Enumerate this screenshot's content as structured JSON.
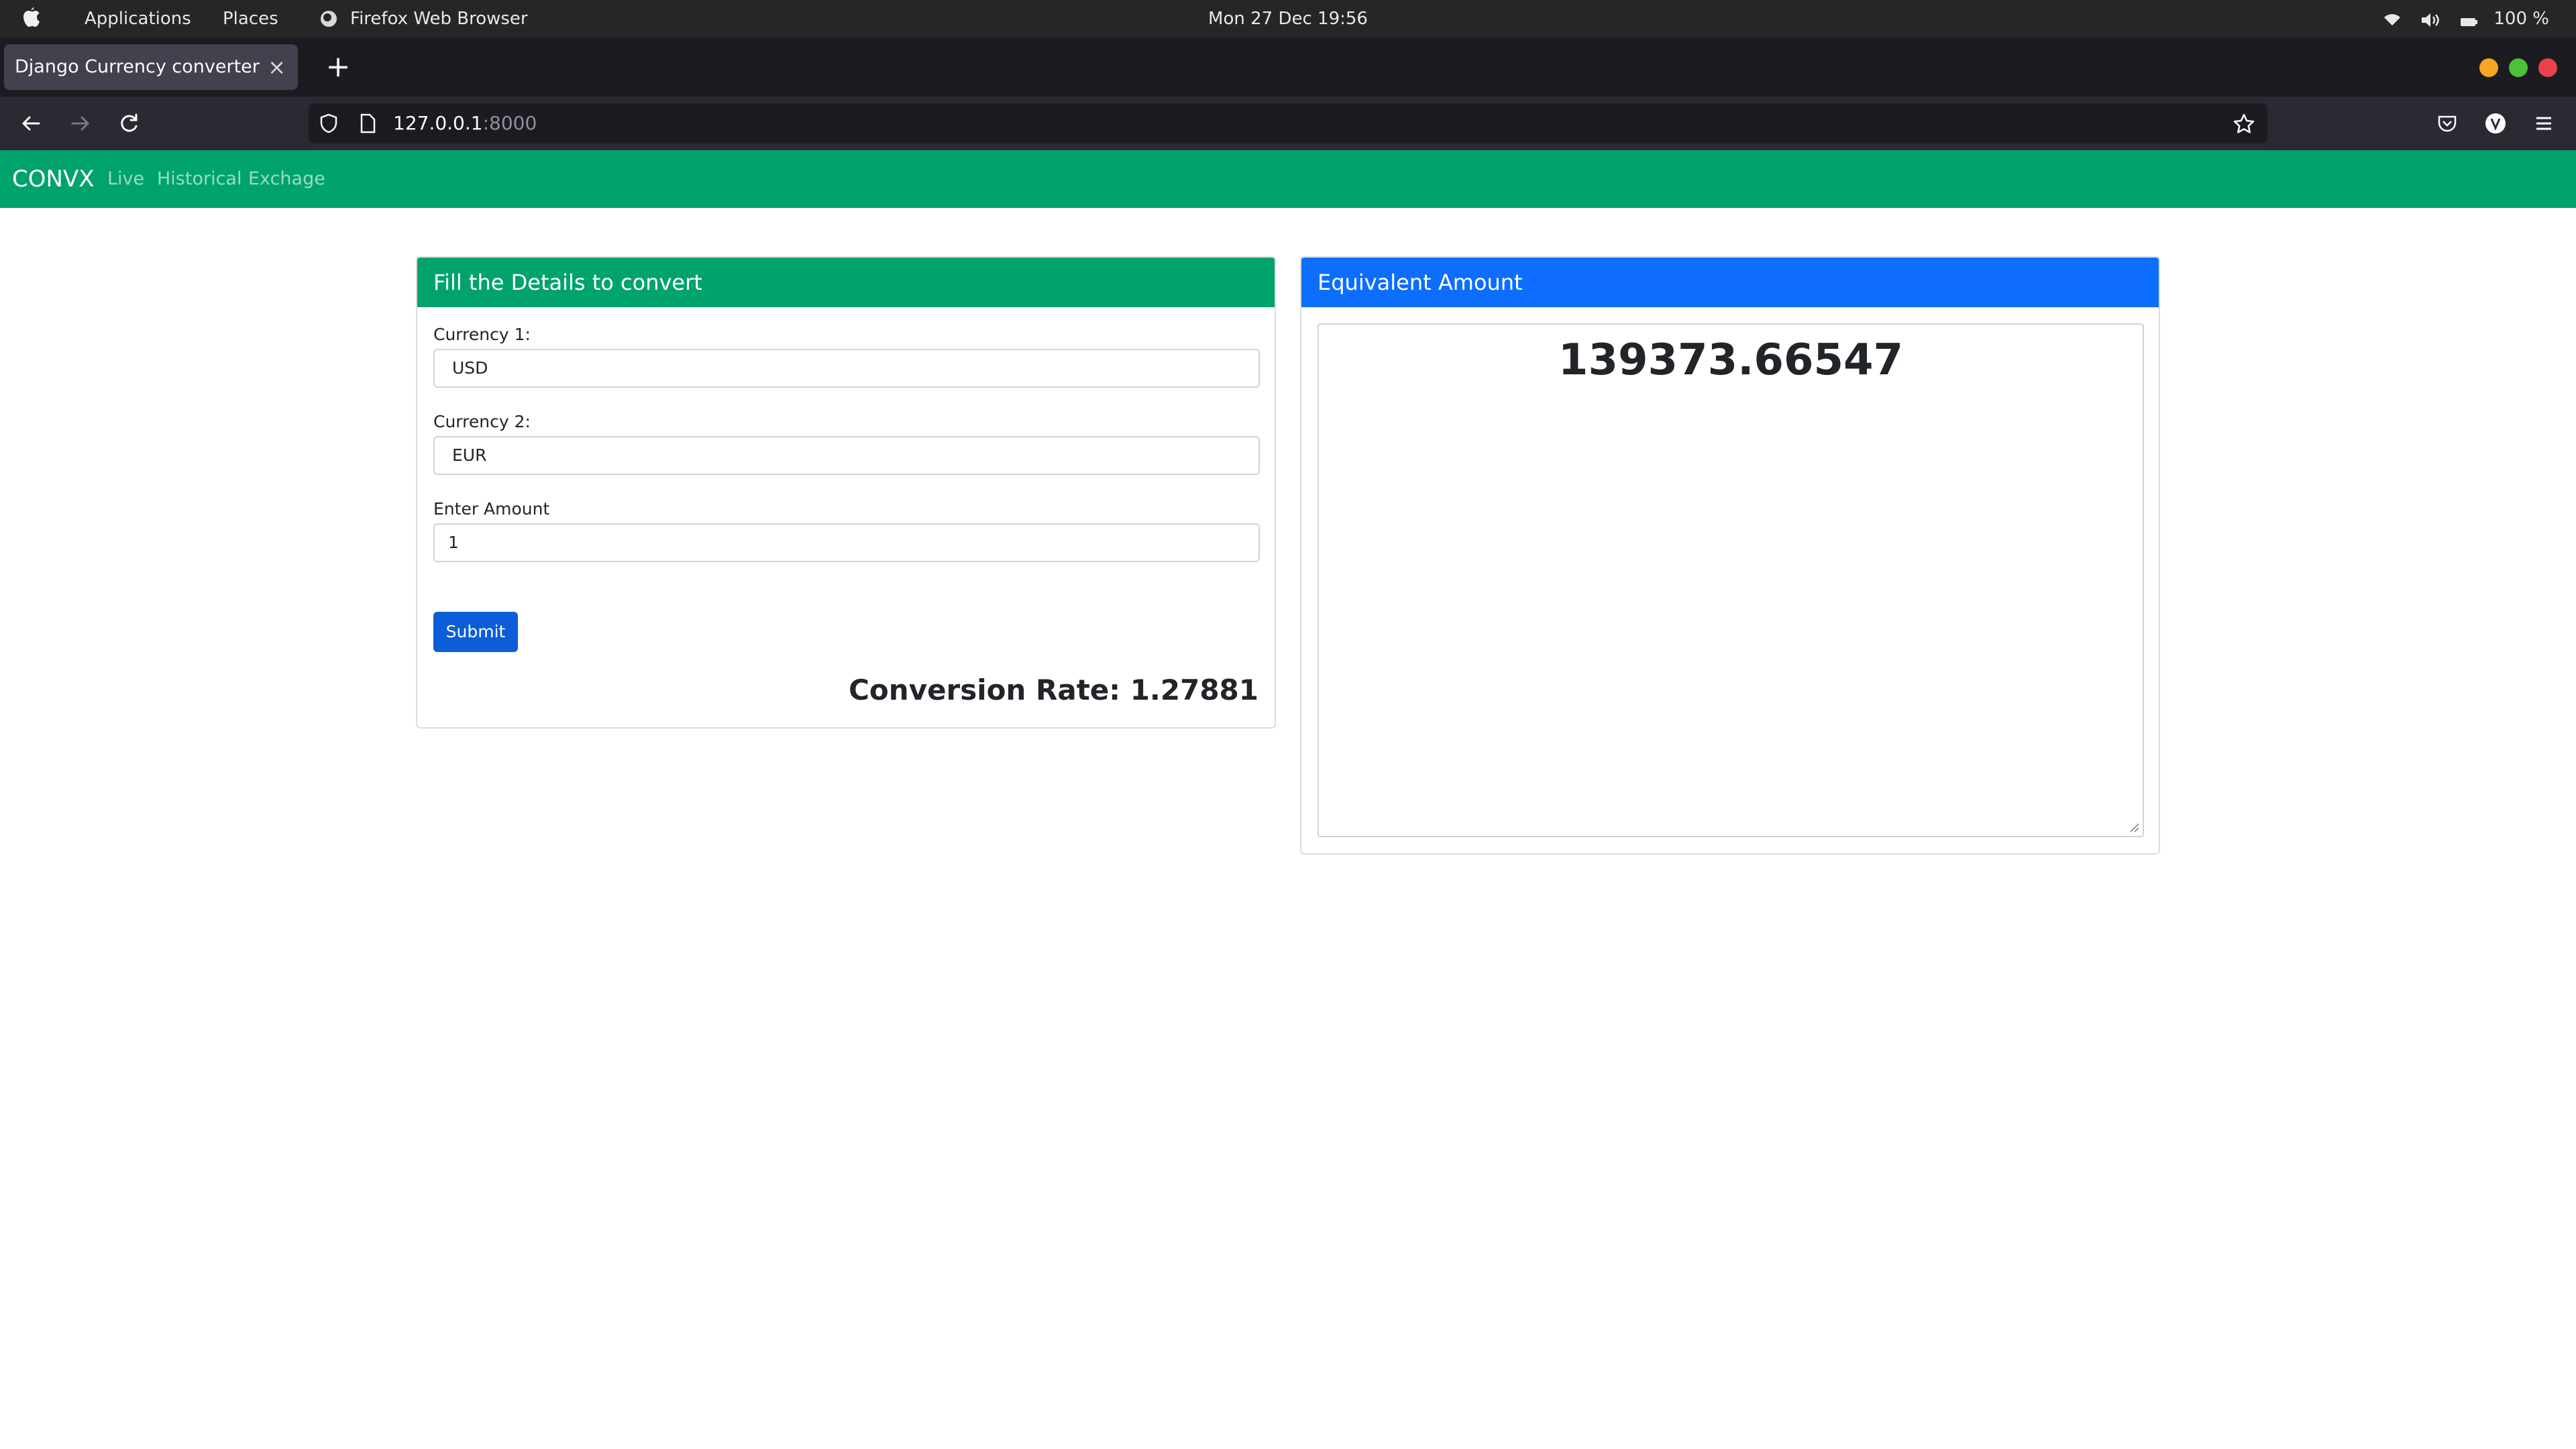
{
  "os": {
    "applications_label": "Applications",
    "places_label": "Places",
    "active_app": "Firefox Web Browser",
    "clock": "Mon 27 Dec  19:56",
    "battery": "100 %"
  },
  "browser": {
    "tab_title": "Django Currency converter",
    "url_host": "127.0.0.1",
    "url_port": ":8000"
  },
  "app_nav": {
    "brand": "CONVX",
    "links": [
      "Live",
      "Historical",
      "Exchage"
    ]
  },
  "form_card": {
    "header": "Fill the Details to convert",
    "currency1_label": "Currency 1:",
    "currency1_value": "USD",
    "currency2_label": "Currency 2:",
    "currency2_value": "EUR",
    "amount_label": "Enter Amount",
    "amount_value": "1",
    "submit_label": "Submit",
    "conversion_rate": "Conversion Rate: 1.27881"
  },
  "result_card": {
    "header": "Equivalent Amount",
    "amount": "139373.66547"
  },
  "colors": {
    "brand_green": "#00a36c",
    "result_blue": "#0d6efd",
    "submit_blue": "#0b5ed7"
  }
}
